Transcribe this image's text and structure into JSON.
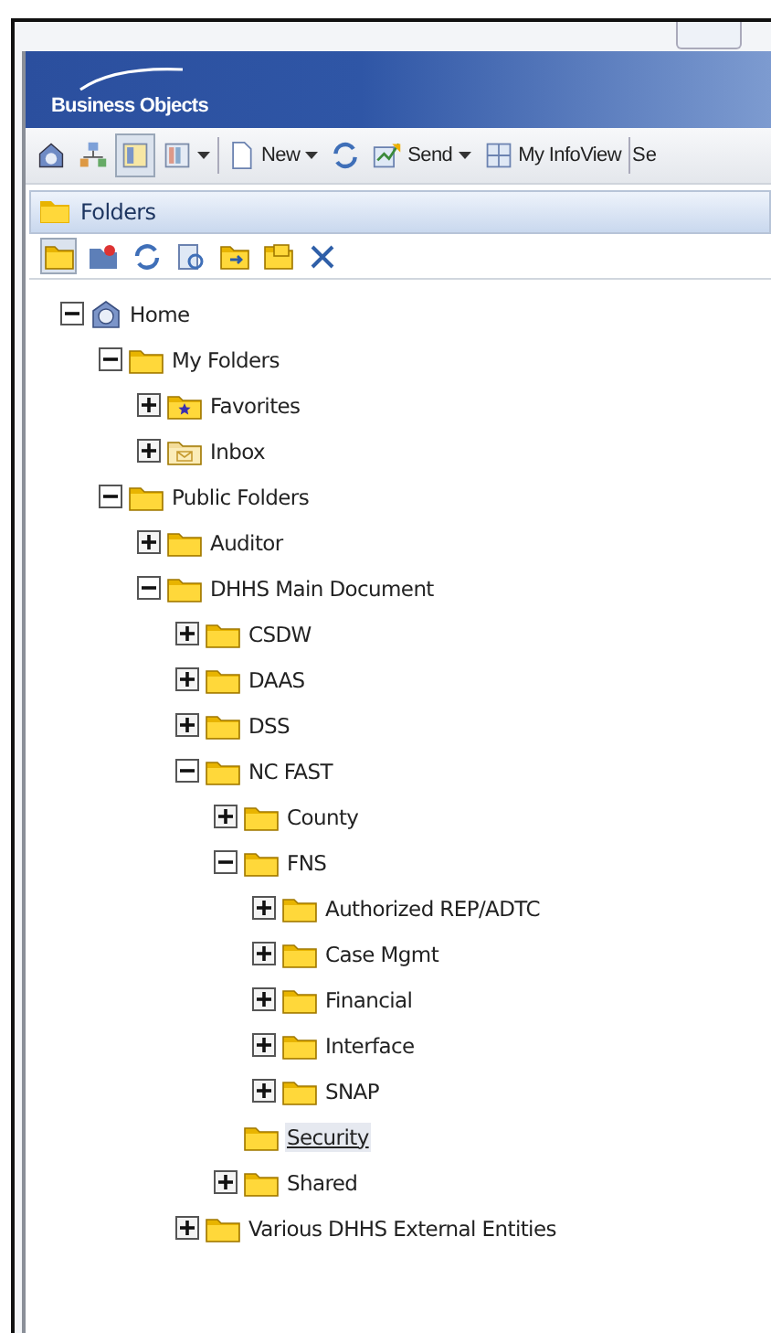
{
  "banner": {
    "logo": "Business Objects"
  },
  "toolbar": [
    {
      "kind": "icon",
      "selected": false
    },
    {
      "kind": "icon",
      "selected": false
    },
    {
      "kind": "icon",
      "selected": true
    },
    {
      "kind": "menu-icon",
      "selected": false
    },
    {
      "kind": "separator"
    },
    {
      "kind": "menu",
      "label": "New",
      "selected": false
    },
    {
      "kind": "icon",
      "selected": false
    },
    {
      "kind": "menu",
      "label": "Send",
      "selected": false
    },
    {
      "kind": "button",
      "label": "My InfoView",
      "selected": false
    },
    {
      "kind": "separator"
    },
    {
      "kind": "text",
      "label": "Se"
    }
  ],
  "panel": {
    "title": "Folders",
    "tools": [
      {
        "selected": true
      },
      {
        "selected": false
      },
      {
        "selected": false
      },
      {
        "selected": false
      },
      {
        "selected": false
      },
      {
        "selected": false
      },
      {
        "selected": false
      }
    ]
  },
  "tree": [
    {
      "label": "Home",
      "kind": "home",
      "expanded": true,
      "selected": false,
      "children": [
        {
          "label": "My Folders",
          "kind": "folder",
          "expanded": true,
          "selected": false,
          "children": [
            {
              "label": "Favorites",
              "kind": "favorites",
              "expanded": false,
              "selected": false
            },
            {
              "label": "Inbox",
              "kind": "inbox",
              "expanded": false,
              "selected": false
            }
          ]
        },
        {
          "label": "Public Folders",
          "kind": "folder",
          "expanded": true,
          "selected": false,
          "children": [
            {
              "label": "Auditor",
              "kind": "folder",
              "expanded": false,
              "selected": false
            },
            {
              "label": "DHHS Main Document",
              "kind": "folder",
              "expanded": true,
              "selected": false,
              "children": [
                {
                  "label": "CSDW",
                  "kind": "folder",
                  "expanded": false,
                  "selected": false
                },
                {
                  "label": "DAAS",
                  "kind": "folder",
                  "expanded": false,
                  "selected": false
                },
                {
                  "label": "DSS",
                  "kind": "folder",
                  "expanded": false,
                  "selected": false
                },
                {
                  "label": "NC FAST",
                  "kind": "folder",
                  "expanded": true,
                  "selected": false,
                  "children": [
                    {
                      "label": "County",
                      "kind": "folder",
                      "expanded": false,
                      "selected": false
                    },
                    {
                      "label": "FNS",
                      "kind": "folder",
                      "expanded": true,
                      "selected": false,
                      "children": [
                        {
                          "label": "Authorized REP/ADTC",
                          "kind": "folder",
                          "expanded": false,
                          "selected": false
                        },
                        {
                          "label": "Case Mgmt",
                          "kind": "folder",
                          "expanded": false,
                          "selected": false
                        },
                        {
                          "label": "Financial",
                          "kind": "folder",
                          "expanded": false,
                          "selected": false
                        },
                        {
                          "label": "Interface",
                          "kind": "folder",
                          "expanded": false,
                          "selected": false
                        },
                        {
                          "label": "SNAP",
                          "kind": "folder",
                          "expanded": false,
                          "selected": false
                        }
                      ]
                    },
                    {
                      "label": "Security",
                      "kind": "leaf-folder",
                      "selected": true
                    },
                    {
                      "label": "Shared",
                      "kind": "folder",
                      "expanded": false,
                      "selected": false
                    }
                  ]
                },
                {
                  "label": "Various DHHS External Entities",
                  "kind": "folder",
                  "expanded": false,
                  "selected": false
                }
              ]
            }
          ]
        }
      ]
    }
  ]
}
